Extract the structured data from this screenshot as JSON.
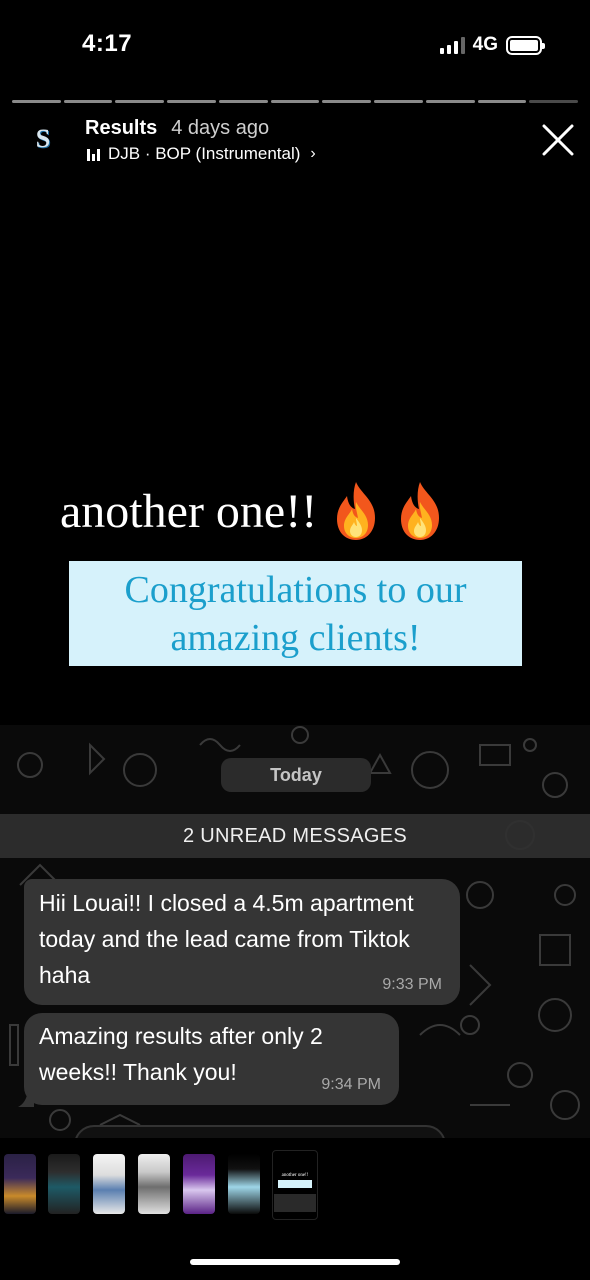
{
  "status_bar": {
    "time": "4:17",
    "network": "4G"
  },
  "story": {
    "account_initial": "S",
    "title": "Results",
    "posted": "4 days ago",
    "music": "DJB · BOP (Instrumental)",
    "segments_total": 11,
    "segments_viewed": 10
  },
  "overlay": {
    "headline": "another one!!",
    "congrats": "Congratulations to our amazing clients!"
  },
  "chat": {
    "date_label": "Today",
    "unread_label": "2 UNREAD MESSAGES",
    "messages": [
      {
        "text": "Hii Louai!! I closed a 4.5m apartment today and the lead came from Tiktok haha",
        "time": "9:33 PM"
      },
      {
        "text": "Amazing results after only 2 weeks!! Thank you!",
        "time": "9:34 PM"
      }
    ]
  },
  "thumbnail_preview": {
    "headline": "another one!!"
  },
  "colors": {
    "background": "#000000",
    "bubble": "#353535",
    "congrats_box": "#d6f2fb",
    "congrats_text": "#1b9fcc"
  }
}
